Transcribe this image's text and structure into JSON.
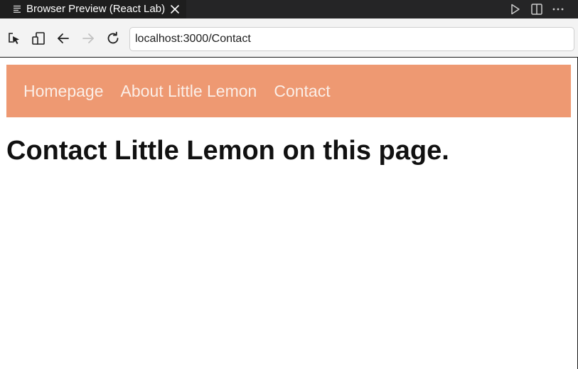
{
  "tab": {
    "title": "Browser Preview (React Lab)",
    "icon": "preview-lines-icon",
    "close_icon": "close-icon"
  },
  "editor_actions": [
    {
      "icon": "run-icon"
    },
    {
      "icon": "split-editor-icon"
    },
    {
      "icon": "more-actions-icon"
    }
  ],
  "toolbar": {
    "inspect_icon": "inspect-element-icon",
    "device_icon": "device-toggle-icon",
    "back_icon": "arrow-left-icon",
    "forward_icon": "arrow-right-icon",
    "reload_icon": "reload-icon",
    "url": "localhost:3000/Contact"
  },
  "page": {
    "nav": {
      "background": "#ee9972",
      "links": [
        {
          "label": "Homepage"
        },
        {
          "label": "About Little Lemon"
        },
        {
          "label": "Contact"
        }
      ]
    },
    "heading": "Contact Little Lemon on this page."
  },
  "colors": {
    "tab_strip": "#252526",
    "active_tab": "#1e1e1e",
    "toolbar": "#f3f3f3",
    "nav_link_text": "#fbeee7"
  }
}
